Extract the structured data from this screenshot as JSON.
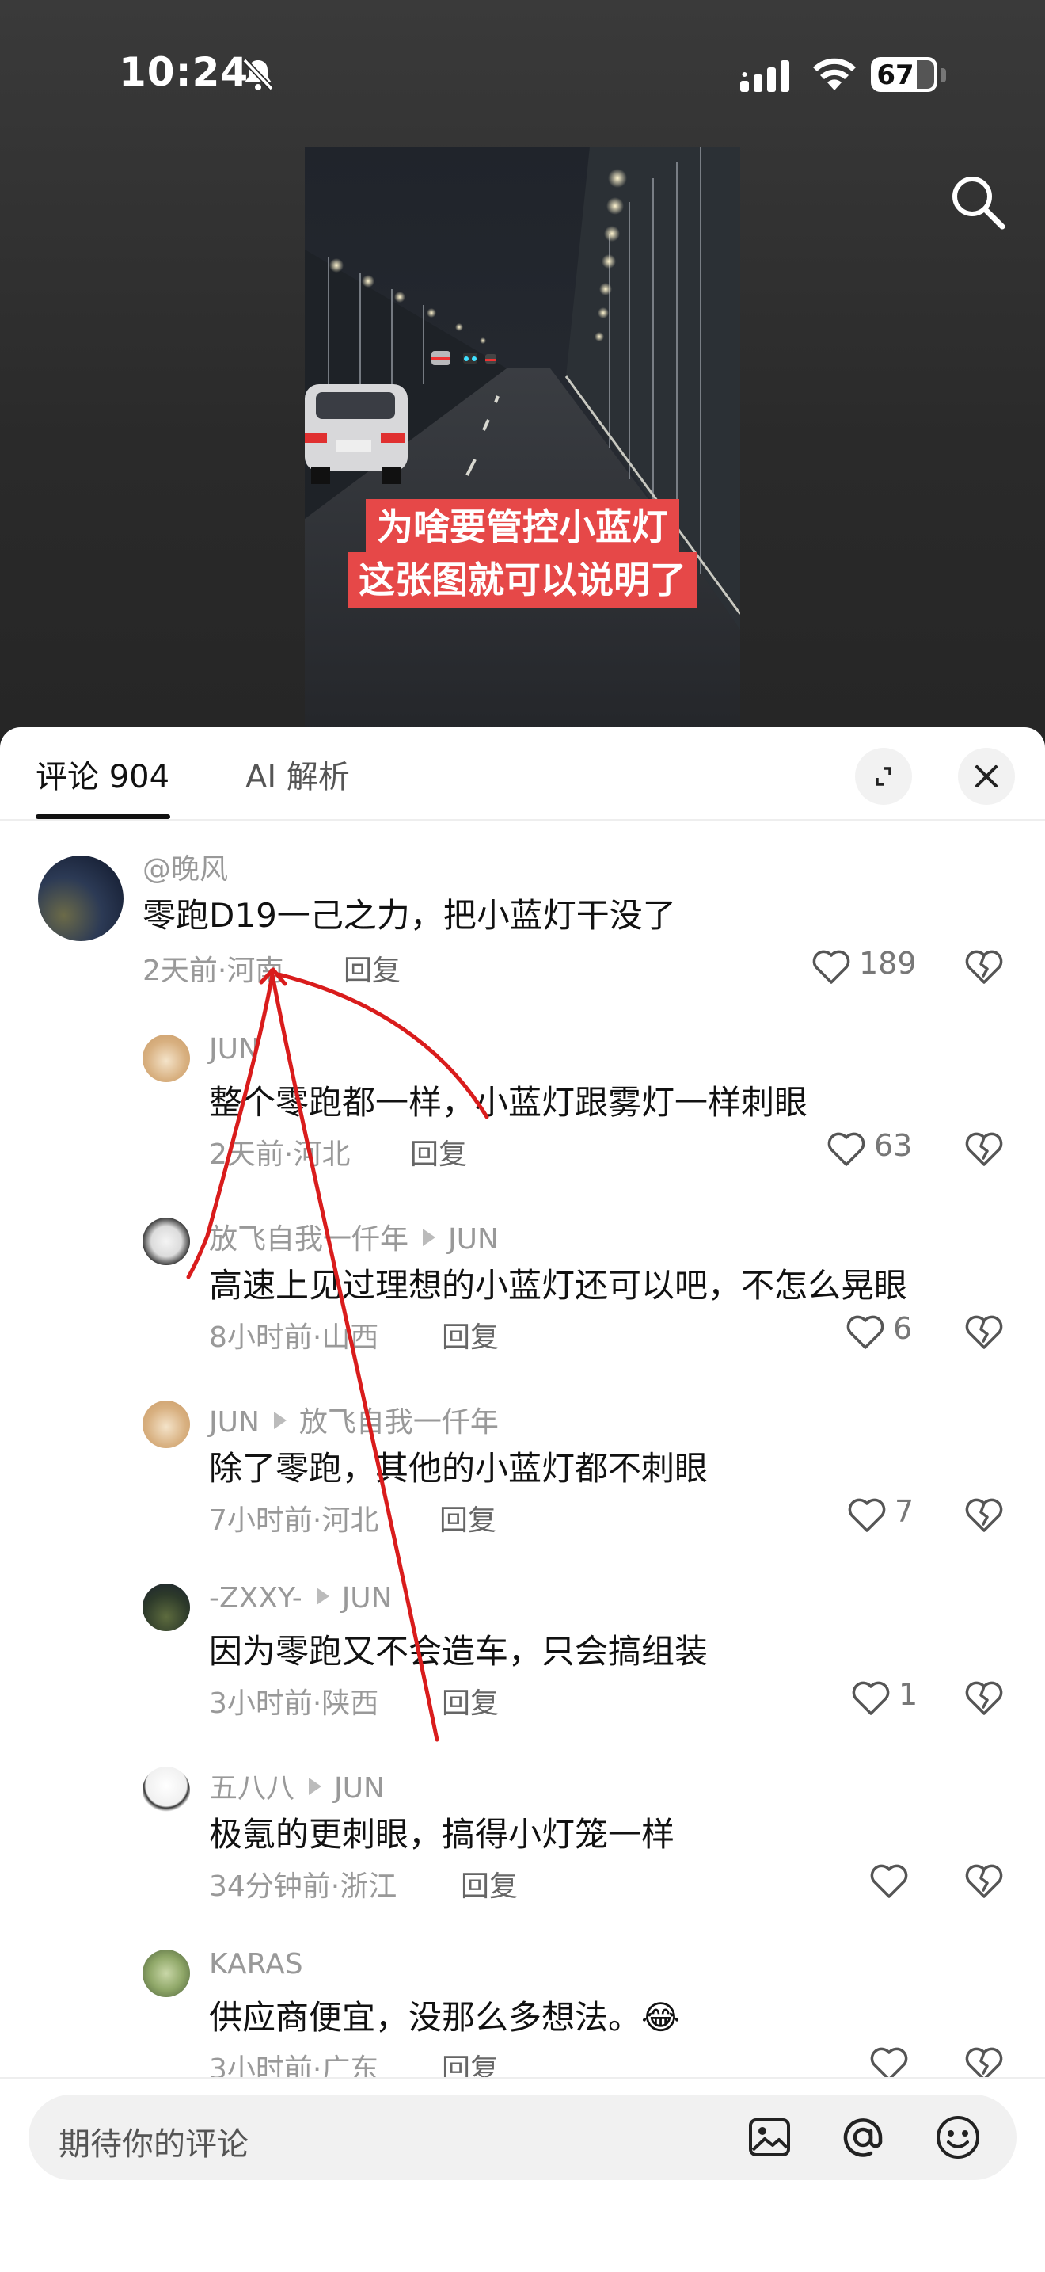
{
  "status_bar": {
    "time": "10:24",
    "battery": "67"
  },
  "video": {
    "caption_line1": "为啥要管控小蓝灯",
    "caption_line2": "这张图就可以说明了"
  },
  "tabs": {
    "comments_label": "评论 904",
    "ai_label": "AI 解析"
  },
  "comments": [
    {
      "user": "@晚风",
      "reply_to": "",
      "text": "零跑D19一己之力，把小蓝灯干没了",
      "meta": "2天前·河南",
      "reply": "回复",
      "likes": "189"
    },
    {
      "user": "JUN",
      "reply_to": "",
      "text": "整个零跑都一样，小蓝灯跟雾灯一样刺眼",
      "meta": "2天前·河北",
      "reply": "回复",
      "likes": "63"
    },
    {
      "user": "放飞自我一仟年",
      "reply_to": "JUN",
      "text": "高速上见过理想的小蓝灯还可以吧，不怎么晃眼",
      "meta": "8小时前·山西",
      "reply": "回复",
      "likes": "6"
    },
    {
      "user": "JUN",
      "reply_to": "放飞自我一仟年",
      "text": "除了零跑，其他的小蓝灯都不刺眼",
      "meta": "7小时前·河北",
      "reply": "回复",
      "likes": "7"
    },
    {
      "user": "-ZXXY-",
      "reply_to": "JUN",
      "text": "因为零跑又不会造车，只会搞组装",
      "meta": "3小时前·陕西",
      "reply": "回复",
      "likes": "1"
    },
    {
      "user": "五八八",
      "reply_to": "JUN",
      "text": "极氪的更刺眼，搞得小灯笼一样",
      "meta": "34分钟前·浙江",
      "reply": "回复",
      "likes": ""
    },
    {
      "user": "KARAS",
      "reply_to": "",
      "text": "供应商便宜，没那么多想法。😂",
      "meta": "3小时前·广东",
      "reply": "回复",
      "likes": ""
    }
  ],
  "input": {
    "placeholder": "期待你的评论"
  },
  "icons": {
    "bell": "bell-slash-icon",
    "signal": "cellular-signal-icon",
    "wifi": "wifi-icon",
    "search": "search-icon",
    "expand": "expand-icon",
    "close": "close-icon",
    "like": "heart-icon",
    "dislike": "broken-heart-icon",
    "image": "image-icon",
    "mention": "at-icon",
    "emoji": "emoji-icon"
  },
  "colors": {
    "caption_bg": "#e64848",
    "annotation": "#d91c1c"
  }
}
